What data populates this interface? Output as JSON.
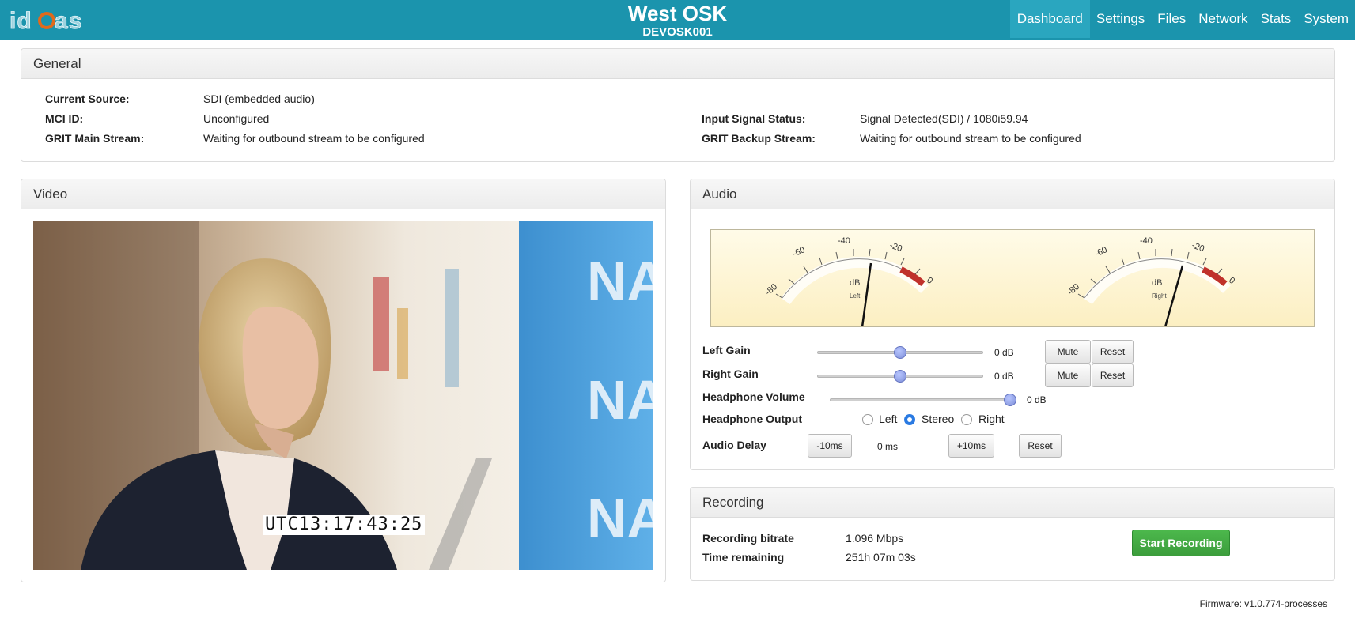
{
  "header": {
    "title": "West OSK",
    "subtitle": "DEVOSK001",
    "nav": [
      "Dashboard",
      "Settings",
      "Files",
      "Network",
      "Stats",
      "System"
    ],
    "active_nav": "Dashboard",
    "brand_color": "#1b94ad"
  },
  "general": {
    "title": "General",
    "rows": [
      {
        "label": "Current Source:",
        "value": "SDI (embedded audio)"
      },
      {
        "label": "MCI ID:",
        "value": "Unconfigured"
      },
      {
        "label": "GRIT Main Stream:",
        "value": "Waiting for outbound stream to be configured"
      },
      {
        "label": "Input Signal Status:",
        "value": "Signal Detected(SDI) / 1080i59.94"
      },
      {
        "label": "GRIT Backup Stream:",
        "value": "Waiting for outbound stream to be configured"
      }
    ]
  },
  "video": {
    "title": "Video",
    "timecode": "UTC13:17:43:25",
    "backdrop_text": "NA"
  },
  "audio": {
    "title": "Audio",
    "meters": [
      {
        "unit": "dB",
        "channel": "Left",
        "ticks": [
          "-80",
          "-60",
          "-40",
          "-20",
          "0"
        ]
      },
      {
        "unit": "dB",
        "channel": "Right",
        "ticks": [
          "-80",
          "-60",
          "-40",
          "-20",
          "0"
        ]
      }
    ],
    "left_gain": {
      "label": "Left Gain",
      "value": "0 dB",
      "level": 0.5,
      "mute": "Mute",
      "reset": "Reset"
    },
    "right_gain": {
      "label": "Right Gain",
      "value": "0 dB",
      "level": 0.5,
      "mute": "Mute",
      "reset": "Reset"
    },
    "headphone_volume": {
      "label": "Headphone Volume",
      "value": "0 dB",
      "level": 1.0
    },
    "headphone_output": {
      "label": "Headphone Output",
      "options": [
        "Left",
        "Stereo",
        "Right"
      ],
      "selected": "Stereo"
    },
    "audio_delay": {
      "label": "Audio Delay",
      "minus": "-10ms",
      "value": "0 ms",
      "plus": "+10ms",
      "reset": "Reset"
    }
  },
  "recording": {
    "title": "Recording",
    "bitrate_label": "Recording bitrate",
    "bitrate_value": "1.096 Mbps",
    "remaining_label": "Time remaining",
    "remaining_value": "251h 07m 03s",
    "start_label": "Start Recording",
    "start_color": "#43a843"
  },
  "footer": {
    "firmware": "Firmware: v1.0.774-processes"
  }
}
